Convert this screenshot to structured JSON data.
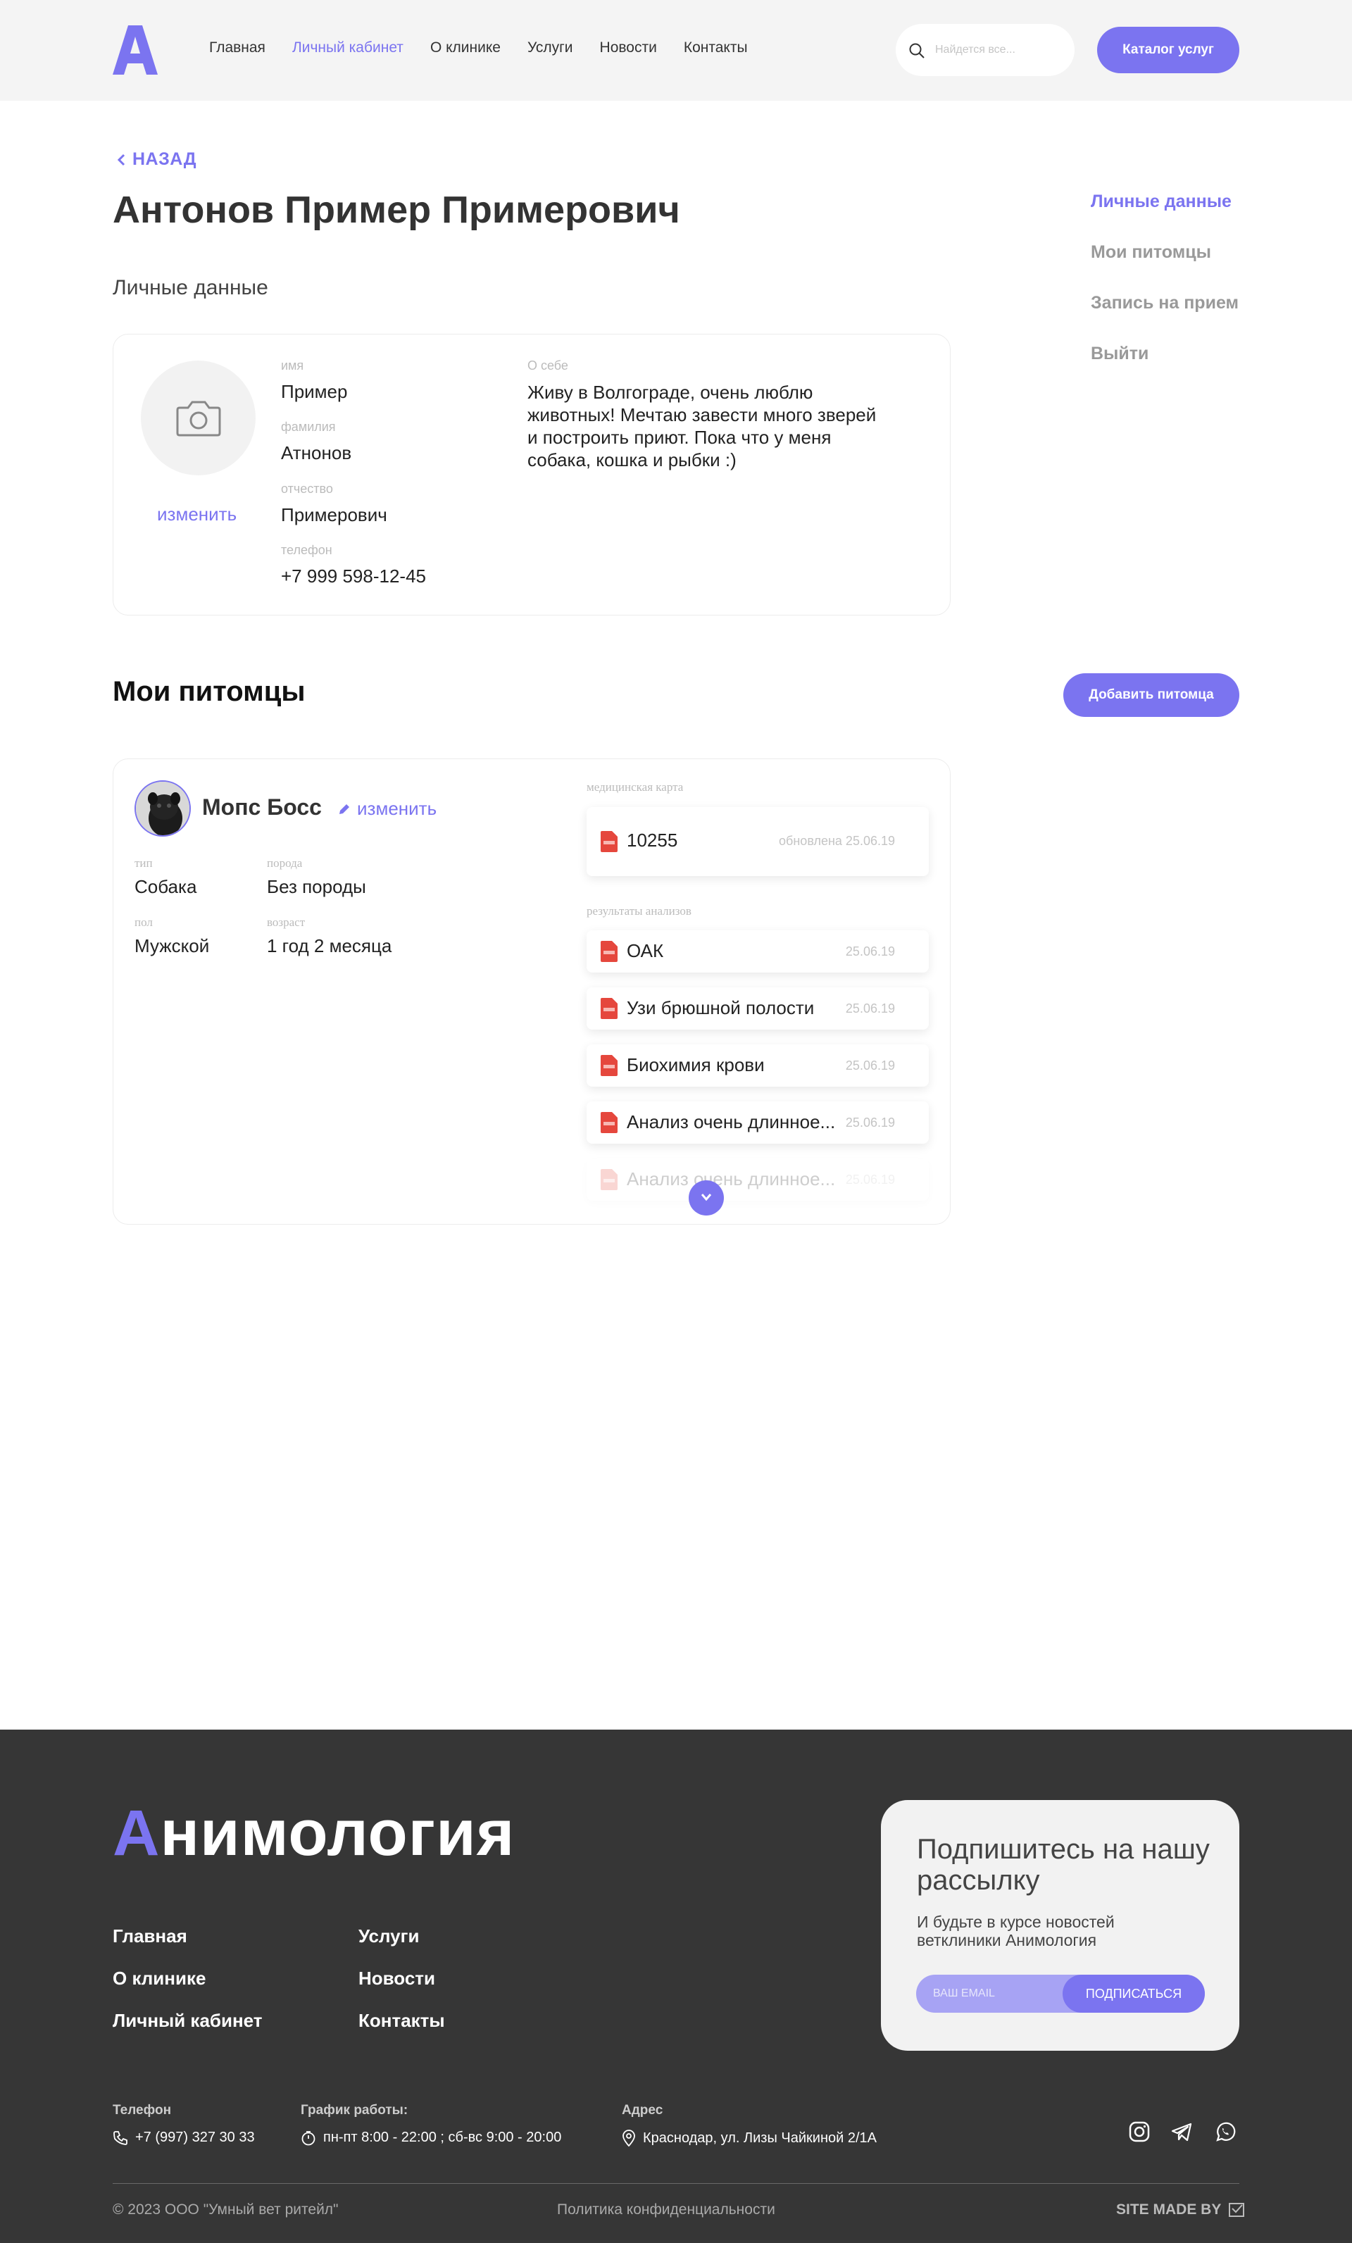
{
  "header": {
    "nav": [
      "Главная",
      "Личный кабинет",
      "О клинике",
      "Услуги",
      "Новости",
      "Контакты"
    ],
    "search_placeholder": "Найдется все...",
    "catalog_button": "Каталог услуг"
  },
  "main": {
    "back_label": "НАЗАД",
    "title": "Антонов Пример Примерович",
    "section_personal": "Личные данные",
    "side_menu": [
      "Личные данные",
      "Мои питомцы",
      "Запись на прием",
      "Выйти"
    ],
    "profile": {
      "change_photo": "изменить",
      "name_label": "имя",
      "name": "Пример",
      "surname_label": "фамилия",
      "surname": "Атнонов",
      "patronymic_label": "отчество",
      "patronymic": "Примерович",
      "phone_label": "телефон",
      "phone": "+7 999 598-12-45",
      "about_label": "О себе",
      "about": "Живу в Волгограде, очень люблю животных! Мечтаю завести много зверей и построить приют. Пока что у меня собака, кошка и рыбки :)"
    },
    "pets_title": "Мои питомцы",
    "add_pet_button": "Добавить питомца",
    "pet": {
      "name": "Мопс Босс",
      "edit_label": "изменить",
      "type_label": "тип",
      "type": "Собака",
      "breed_label": "порода",
      "breed": "Без породы",
      "sex_label": "пол",
      "sex": "Мужской",
      "age_label": "возраст",
      "age": "1 год 2 месяца",
      "med_card_label": "медицинская карта",
      "med_card": {
        "number": "10255",
        "updated": "обновлена 25.06.19"
      },
      "results_label": "результаты анализов",
      "results": [
        {
          "name": "ОАК",
          "date": "25.06.19"
        },
        {
          "name": "Узи брюшной полости",
          "date": "25.06.19"
        },
        {
          "name": "Биохимия крови",
          "date": "25.06.19"
        },
        {
          "name": "Анализ очень длинное...",
          "date": "25.06.19"
        },
        {
          "name": "Анализ очень длинное...",
          "date": "25.06.19"
        }
      ]
    }
  },
  "footer": {
    "brand_first": "А",
    "brand_rest": "нимология",
    "links": [
      "Главная",
      "О клинике",
      "Личный кабинет",
      "Услуги",
      "Новости",
      "Контакты"
    ],
    "subscribe": {
      "title": "Подпишитесь на нашу рассылку",
      "text": "И будьте в курсе новостей ветклиники Анимология",
      "email_placeholder": "ВАШ EMAIL",
      "button": "ПОДПИСАТЬСЯ"
    },
    "phone_label": "Телефон",
    "phone": "+7 (997) 327 30 33",
    "schedule_label": "График работы:",
    "schedule": "пн-пт 8:00 - 22:00 ; сб-вс 9:00 - 20:00",
    "address_label": "Адрес",
    "address": "Краснодар, ул. Лизы Чайкиной 2/1А",
    "copyright": "© 2023 ООО \"Умный вет ритейл\"",
    "privacy": "Политика конфиденциальности",
    "site_made_by": "SITE MADE BY",
    "accent_color": "#7b74f0"
  }
}
